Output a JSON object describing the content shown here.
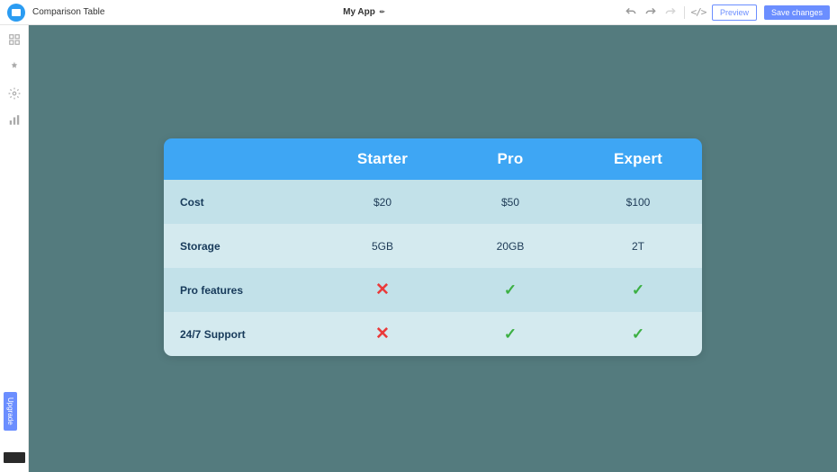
{
  "topbar": {
    "component_name": "Comparison Table",
    "app_name": "My App",
    "preview_label": "Preview",
    "save_label": "Save changes"
  },
  "sidebar": {
    "upgrade_label": "Upgrade",
    "icons": {
      "grid": "grid-icon",
      "pin": "pin-icon",
      "gear": "gear-icon",
      "stats": "stats-icon"
    }
  },
  "chart_data": {
    "type": "table",
    "columns": [
      "Starter",
      "Pro",
      "Expert"
    ],
    "rows": [
      {
        "label": "Cost",
        "values": [
          "$20",
          "$50",
          "$100"
        ],
        "kind": "text"
      },
      {
        "label": "Storage",
        "values": [
          "5GB",
          "20GB",
          "2T"
        ],
        "kind": "text"
      },
      {
        "label": "Pro features",
        "values": [
          false,
          true,
          true
        ],
        "kind": "bool"
      },
      {
        "label": "24/7 Support",
        "values": [
          false,
          true,
          true
        ],
        "kind": "bool"
      }
    ]
  }
}
